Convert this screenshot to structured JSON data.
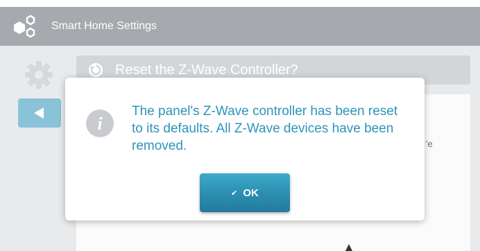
{
  "header": {
    "title": "Smart Home Settings",
    "logo_icon": "smart-home-logo-icon"
  },
  "sidebar": {
    "settings_icon": "gear-icon",
    "back_icon": "back-arrow-icon"
  },
  "page": {
    "title": "Reset the Z-Wave Controller?",
    "title_icon": "reset-icon",
    "partial_text": "'e"
  },
  "dialog": {
    "icon": "info-icon",
    "message": "The panel's Z-Wave controller has been reset to its defaults. All Z-Wave devices have been removed.",
    "ok_check": "✔",
    "ok_label": "OK"
  },
  "colors": {
    "header_bg": "#a6a9ad",
    "accent": "#2e93ba",
    "back_button_bg": "#8ac3d7",
    "dialog_bg": "#ffffff"
  }
}
